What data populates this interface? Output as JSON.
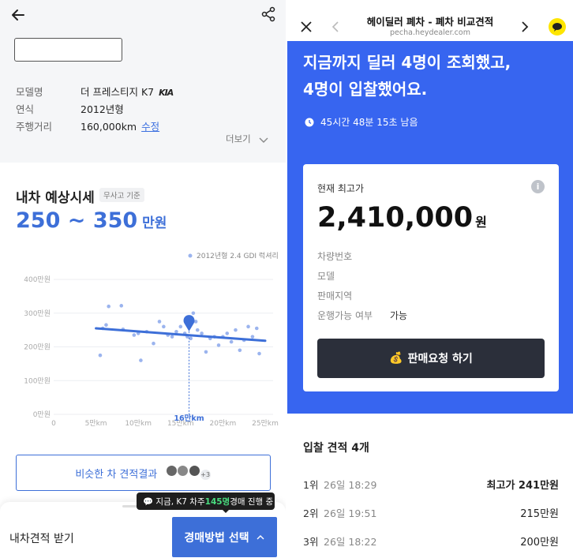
{
  "left": {
    "specs": [
      {
        "label": "모델명",
        "value": "더 프레스티지 K7"
      },
      {
        "label": "연식",
        "value": "2012년형"
      },
      {
        "label": "주행거리",
        "value": "160,000km"
      }
    ],
    "edit_label": "수정",
    "kia_logo_text": "KIA",
    "more_label": "더보기",
    "section_title": "내차 예상시세",
    "section_tag": "무사고 기준",
    "price_low": "250",
    "price_sep": " ~ ",
    "price_high": "350",
    "price_unit": " 만원",
    "similar_button": "비슷한 차 견적결과",
    "avatar_more": "+3",
    "tooltip_prefix": "💬 지금, K7 차주 ",
    "tooltip_count": "145명",
    "tooltip_suffix": " 경매 진행 중",
    "receive_label": "내차견적 받기",
    "auction_button": "경매방법 선택",
    "icons": {
      "back": "back-arrow-icon",
      "share": "share-icon",
      "chevron": "chevron-down-icon",
      "up": "chevron-up-icon"
    }
  },
  "chart_data": {
    "type": "scatter",
    "legend": "2012년형 2.4 GDI 럭셔리",
    "x_ticks": [
      "0",
      "5만km",
      "10만km",
      "15만km",
      "20만km",
      "25만km"
    ],
    "y_ticks": [
      "0만원",
      "100만원",
      "200만원",
      "300만원",
      "400만원"
    ],
    "xlim": [
      0,
      250000
    ],
    "ylim": [
      0,
      400
    ],
    "marker_label": "16만km",
    "marker": {
      "x": 160000,
      "y": 265
    },
    "trend": [
      {
        "x": 50000,
        "y": 255
      },
      {
        "x": 250000,
        "y": 218
      }
    ],
    "points": [
      {
        "x": 55000,
        "y": 175
      },
      {
        "x": 58000,
        "y": 255
      },
      {
        "x": 62000,
        "y": 265
      },
      {
        "x": 65000,
        "y": 320
      },
      {
        "x": 80000,
        "y": 322
      },
      {
        "x": 82000,
        "y": 252
      },
      {
        "x": 95000,
        "y": 235
      },
      {
        "x": 100000,
        "y": 240
      },
      {
        "x": 103000,
        "y": 160
      },
      {
        "x": 110000,
        "y": 245
      },
      {
        "x": 118000,
        "y": 210
      },
      {
        "x": 125000,
        "y": 275
      },
      {
        "x": 130000,
        "y": 260
      },
      {
        "x": 135000,
        "y": 235
      },
      {
        "x": 140000,
        "y": 230
      },
      {
        "x": 145000,
        "y": 245
      },
      {
        "x": 150000,
        "y": 260
      },
      {
        "x": 155000,
        "y": 240
      },
      {
        "x": 158000,
        "y": 230
      },
      {
        "x": 162000,
        "y": 225
      },
      {
        "x": 165000,
        "y": 300
      },
      {
        "x": 168000,
        "y": 275
      },
      {
        "x": 170000,
        "y": 250
      },
      {
        "x": 175000,
        "y": 240
      },
      {
        "x": 180000,
        "y": 185
      },
      {
        "x": 185000,
        "y": 225
      },
      {
        "x": 190000,
        "y": 230
      },
      {
        "x": 195000,
        "y": 205
      },
      {
        "x": 200000,
        "y": 230
      },
      {
        "x": 205000,
        "y": 240
      },
      {
        "x": 210000,
        "y": 215
      },
      {
        "x": 215000,
        "y": 250
      },
      {
        "x": 220000,
        "y": 190
      },
      {
        "x": 225000,
        "y": 220
      },
      {
        "x": 230000,
        "y": 260
      },
      {
        "x": 235000,
        "y": 230
      },
      {
        "x": 240000,
        "y": 255
      },
      {
        "x": 243000,
        "y": 180
      }
    ]
  },
  "right": {
    "title": "헤이딜러 폐차 - 폐차 비교견적",
    "url": "pecha.heydealer.com",
    "headline_1": "지금까지 딜러 4명이 조회했고,",
    "headline_2": "4명이 입찰했어요.",
    "timer": "45시간 48분 15초 남음",
    "card_label": "현재 최고가",
    "card_price": "2,410,000",
    "card_won": "원",
    "rows": [
      {
        "label": "차량번호",
        "value": ""
      },
      {
        "label": "모델",
        "value": ""
      },
      {
        "label": "판매지역",
        "value": ""
      },
      {
        "label": "운행가능 여부",
        "value": "가능"
      }
    ],
    "sell_button": "판매요청 하기",
    "bids_title": "입찰 견적 4개",
    "bids": [
      {
        "rank": "1위",
        "time": "26일 18:29",
        "amount": "최고가 241만원"
      },
      {
        "rank": "2위",
        "time": "26일 19:51",
        "amount": "215만원"
      },
      {
        "rank": "3위",
        "time": "26일 18:22",
        "amount": "200만원"
      }
    ],
    "colors": {
      "accent": "#3765f0",
      "dark_button": "#2b2f3a",
      "kakao": "#fee500"
    }
  }
}
